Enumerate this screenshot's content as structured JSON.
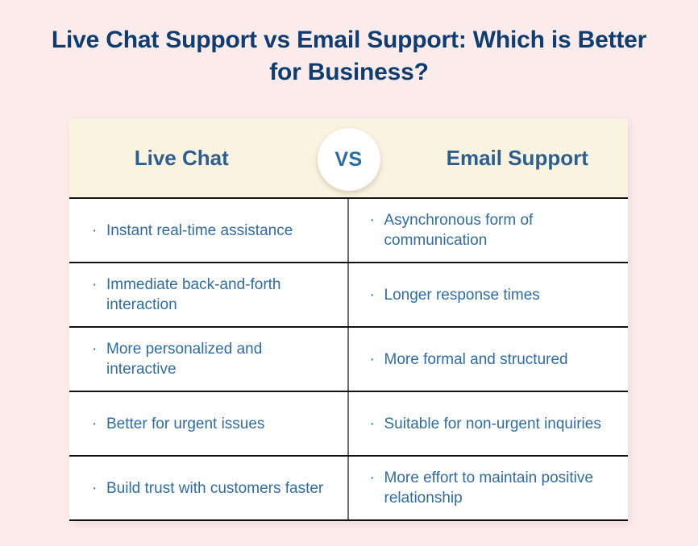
{
  "title": "Live Chat Support vs Email Support: Which is Better for Business?",
  "table": {
    "header": {
      "left_label": "Live Chat",
      "vs_label": "VS",
      "right_label": "Email Support"
    },
    "bullet_glyph": "·",
    "rows": [
      {
        "left": "Instant real-time assistance",
        "right": "Asynchronous form of communication"
      },
      {
        "left": "Immediate back-and-forth interaction",
        "right": "Longer response times"
      },
      {
        "left": "More personalized and interactive",
        "right": "More formal and structured"
      },
      {
        "left": "Better for urgent issues",
        "right": "Suitable for non-urgent inquiries"
      },
      {
        "left": "Build trust with customers faster",
        "right": "More effort to maintain positive relationship"
      }
    ]
  },
  "colors": {
    "background": "#fbeceb",
    "title_text": "#0d3d72",
    "header_band": "#faf3e0",
    "header_text": "#2c5f91",
    "body_text": "#2f6ca5",
    "vs_text": "#2b6ca3",
    "row_divider": "#131313",
    "column_divider": "#6b6b6b",
    "cell_background": "#ffffff"
  }
}
